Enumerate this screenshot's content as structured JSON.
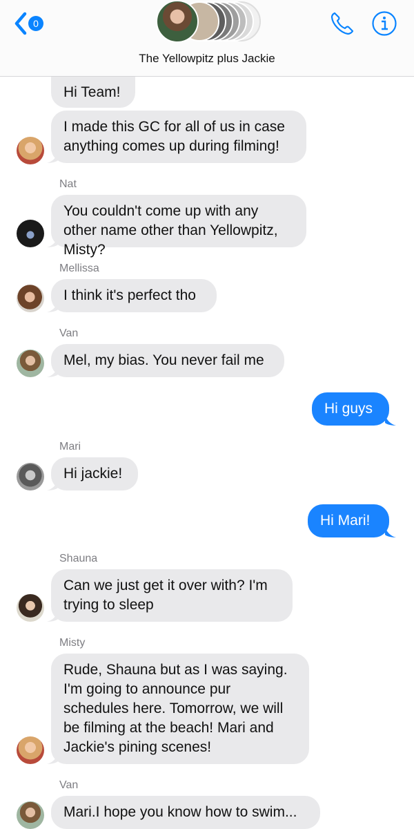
{
  "header": {
    "unread_count": "0",
    "title": "The Yellowpitz plus Jackie",
    "icons": {
      "back": "chevron-left-icon",
      "call": "phone-icon",
      "info": "info-icon"
    },
    "accent": "#0a84ff"
  },
  "messages": [
    {
      "sender": "",
      "text": "Hi Team!",
      "dir": "in"
    },
    {
      "sender": "",
      "text": "I made this GC for all of us in case anything comes up during filming!",
      "dir": "in"
    },
    {
      "sender": "Nat",
      "text": "You couldn't come up with any other name other than Yellowpitz, Misty?",
      "dir": "in"
    },
    {
      "sender": "Mellissa",
      "text": "I think it's perfect tho",
      "dir": "in"
    },
    {
      "sender": "Van",
      "text": "Mel, my bias. You never fail me",
      "dir": "in"
    },
    {
      "sender": "",
      "text": "Hi guys",
      "dir": "out"
    },
    {
      "sender": "Mari",
      "text": "Hi jackie!",
      "dir": "in"
    },
    {
      "sender": "",
      "text": "Hi Mari!",
      "dir": "out"
    },
    {
      "sender": "Shauna",
      "text": "Can we just get it over with? I'm trying to sleep",
      "dir": "in"
    },
    {
      "sender": "Misty",
      "text": "Rude, Shauna but as I was saying. I'm going to announce pur schedules here. Tomorrow, we will be filming at the beach! Mari and Jackie's pining scenes!",
      "dir": "in"
    },
    {
      "sender": "Van",
      "text": "Mari.I hope you know how to swim...",
      "dir": "in"
    }
  ],
  "colors": {
    "incoming_bubble": "#e9e9eb",
    "outgoing_bubble": "#1a84ff"
  }
}
